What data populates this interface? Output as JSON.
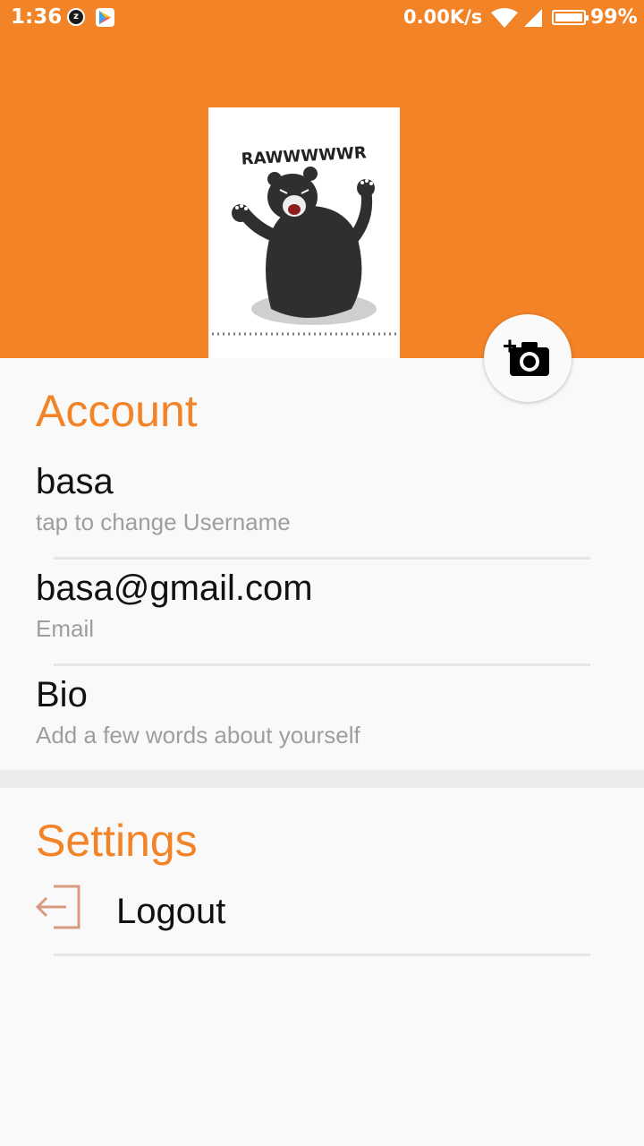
{
  "status_bar": {
    "time": "1:36",
    "network_speed": "0.00K/s",
    "battery_percent": "99%",
    "icons": [
      "app-notification-icon",
      "play-games-icon",
      "wifi-icon",
      "signal-icon",
      "battery-icon"
    ]
  },
  "profile": {
    "avatar_caption": "RAWWWWWR",
    "change_photo_icon": "add-photo-camera-icon"
  },
  "account": {
    "title": "Account",
    "username": {
      "value": "basa",
      "hint": "tap to change Username"
    },
    "email": {
      "value": "basa@gmail.com",
      "hint": "Email"
    },
    "bio": {
      "value": "Bio",
      "hint": "Add a few words about yourself"
    }
  },
  "settings": {
    "title": "Settings",
    "logout": {
      "label": "Logout",
      "icon": "logout-icon"
    }
  },
  "colors": {
    "accent": "#f38327",
    "background": "#f9f9f9",
    "hint_text": "#9e9e9e"
  }
}
